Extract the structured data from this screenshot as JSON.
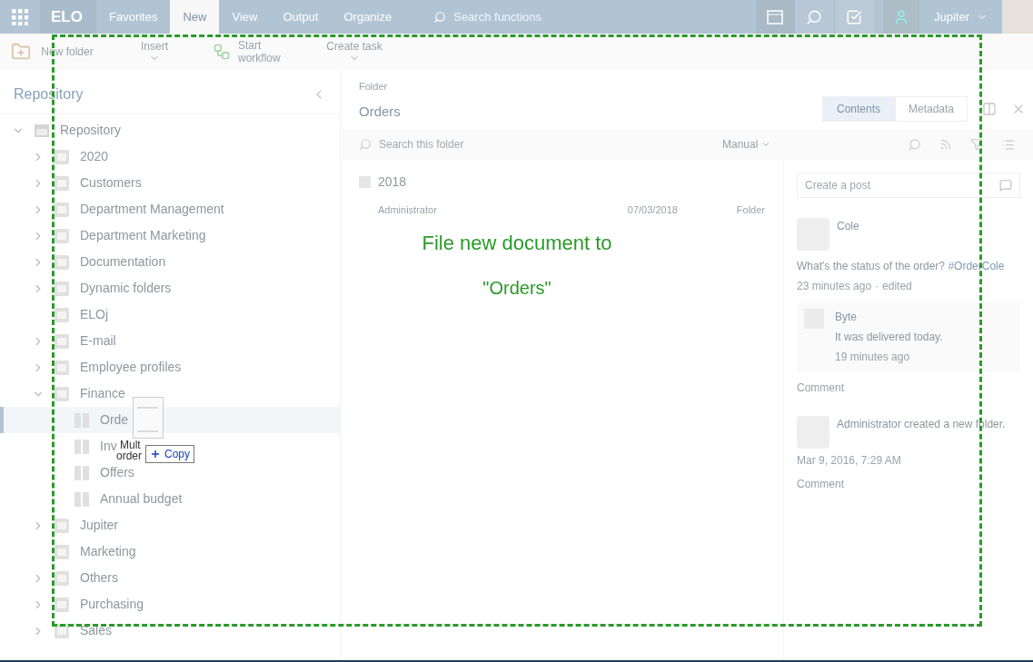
{
  "topbar": {
    "logo": "ELO",
    "tabs": [
      {
        "label": "Favorites",
        "selected": false
      },
      {
        "label": "New",
        "selected": true
      },
      {
        "label": "View",
        "selected": false
      },
      {
        "label": "Output",
        "selected": false
      },
      {
        "label": "Organize",
        "selected": false
      }
    ],
    "search": {
      "placeholder": "Search functions"
    },
    "user": "Jupiter"
  },
  "ribbon": [
    {
      "kind": "folder",
      "label": "New folder"
    },
    {
      "kind": "menu",
      "label": "Insert"
    },
    {
      "kind": "workflow",
      "label": "Start workflow"
    },
    {
      "kind": "menu",
      "label": "Create task"
    }
  ],
  "sidebar": {
    "title": "Repository",
    "tree": [
      {
        "label": "Repository",
        "kind": "root",
        "expanded": true,
        "selected": false,
        "expandable": true,
        "children": [
          {
            "label": "2020",
            "kind": "cabinet",
            "expanded": false,
            "selected": false,
            "expandable": true
          },
          {
            "label": "Customers",
            "kind": "cabinet",
            "expanded": false,
            "selected": false,
            "expandable": true
          },
          {
            "label": "Department Management",
            "kind": "cabinet",
            "expanded": false,
            "selected": false,
            "expandable": true
          },
          {
            "label": "Department Marketing",
            "kind": "cabinet",
            "expanded": false,
            "selected": false,
            "expandable": true
          },
          {
            "label": "Documentation",
            "kind": "cabinet",
            "expanded": false,
            "selected": false,
            "expandable": true
          },
          {
            "label": "Dynamic folders",
            "kind": "cabinet",
            "expanded": false,
            "selected": false,
            "expandable": true
          },
          {
            "label": "ELOj",
            "kind": "cabinet",
            "expanded": false,
            "selected": false,
            "expandable": false
          },
          {
            "label": "E-mail",
            "kind": "cabinet",
            "expanded": false,
            "selected": false,
            "expandable": true
          },
          {
            "label": "Employee profiles",
            "kind": "cabinet",
            "expanded": false,
            "selected": false,
            "expandable": true
          },
          {
            "label": "Finance",
            "kind": "cabinet",
            "expanded": true,
            "selected": false,
            "expandable": true,
            "children": [
              {
                "label": "Orde",
                "kind": "folder",
                "expanded": false,
                "selected": true,
                "expandable": false
              },
              {
                "label": "Inv",
                "kind": "folder",
                "expanded": false,
                "selected": false,
                "expandable": false
              },
              {
                "label": "Offers",
                "kind": "folder",
                "expanded": false,
                "selected": false,
                "expandable": false
              },
              {
                "label": "Annual budget",
                "kind": "folder",
                "expanded": false,
                "selected": false,
                "expandable": false
              }
            ]
          },
          {
            "label": "Jupiter",
            "kind": "cabinet",
            "expanded": false,
            "selected": false,
            "expandable": true
          },
          {
            "label": "Marketing",
            "kind": "cabinet",
            "expanded": false,
            "selected": false,
            "expandable": false
          },
          {
            "label": "Others",
            "kind": "cabinet",
            "expanded": false,
            "selected": false,
            "expandable": true
          },
          {
            "label": "Purchasing",
            "kind": "cabinet",
            "expanded": false,
            "selected": false,
            "expandable": true
          },
          {
            "label": "Sales",
            "kind": "cabinet",
            "expanded": false,
            "selected": false,
            "expandable": true
          }
        ]
      }
    ]
  },
  "content": {
    "breadcrumb": "Folder",
    "title": "Orders",
    "tabs": [
      {
        "label": "Contents",
        "selected": true
      },
      {
        "label": "Metadata",
        "selected": false
      }
    ],
    "search": {
      "placeholder": "Search this folder"
    },
    "sort": "Manual",
    "items": [
      {
        "name": "2018",
        "owner": "Administrator",
        "date": "07/03/2018",
        "type": "Folder"
      }
    ]
  },
  "feed": {
    "post_placeholder": "Create a post",
    "posts": [
      {
        "author": "Cole",
        "text": "What's the status of the order? ",
        "tag": "#OrderCole",
        "time": "23 minutes ago",
        "separator": "·",
        "edited": "edited",
        "replies": [
          {
            "author": "Byte",
            "text": "It was delivered today.",
            "time": "19 minutes ago"
          }
        ],
        "action": "Comment"
      },
      {
        "author": "Administrator",
        "text": " created a new folder.",
        "time": "Mar 9, 2016, 7:29 AM",
        "action": "Comment"
      }
    ]
  },
  "drag": {
    "file_label_1": "Mult",
    "file_label_2": "order",
    "badge": "Copy",
    "drop_title": "File new document to",
    "drop_target": "\"Orders\""
  }
}
